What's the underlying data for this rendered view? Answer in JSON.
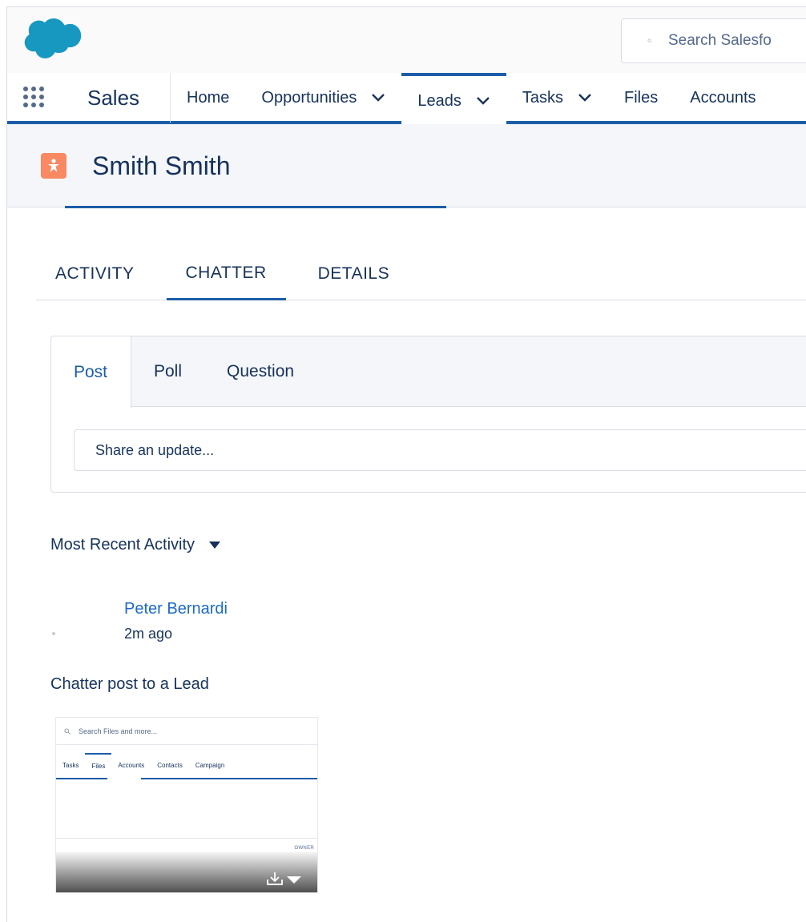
{
  "header": {
    "search_placeholder": "Search Salesfo"
  },
  "nav": {
    "app_name": "Sales",
    "items": [
      {
        "label": "Home",
        "has_menu": false
      },
      {
        "label": "Opportunities",
        "has_menu": true
      },
      {
        "label": "Leads",
        "has_menu": true,
        "active": true
      },
      {
        "label": "Tasks",
        "has_menu": true
      },
      {
        "label": "Files",
        "has_menu": false
      },
      {
        "label": "Accounts",
        "has_menu": false
      }
    ]
  },
  "record": {
    "title": "Smith Smith"
  },
  "tabs": [
    {
      "label": "ACTIVITY"
    },
    {
      "label": "CHATTER",
      "active": true
    },
    {
      "label": "DETAILS"
    }
  ],
  "publisher": {
    "tabs": [
      {
        "label": "Post",
        "active": true
      },
      {
        "label": "Poll"
      },
      {
        "label": "Question"
      }
    ],
    "input_placeholder": "Share an update..."
  },
  "feed": {
    "filter_label": "Most Recent Activity",
    "post": {
      "author": "Peter Bernardi",
      "time": "2m ago",
      "body": "Chatter post to a Lead"
    }
  },
  "thumbnail": {
    "search_text": "Search Files and more...",
    "nav": [
      "Tasks",
      "Files",
      "Accounts",
      "Contacts",
      "Campaign"
    ],
    "owner_label": "OWNER"
  },
  "colors": {
    "brand_blue": "#1b5da8",
    "link_blue": "#1b6ac9",
    "text": "#16325c",
    "lead_icon": "#f88962",
    "salesforce_cloud": "#1798c1"
  }
}
